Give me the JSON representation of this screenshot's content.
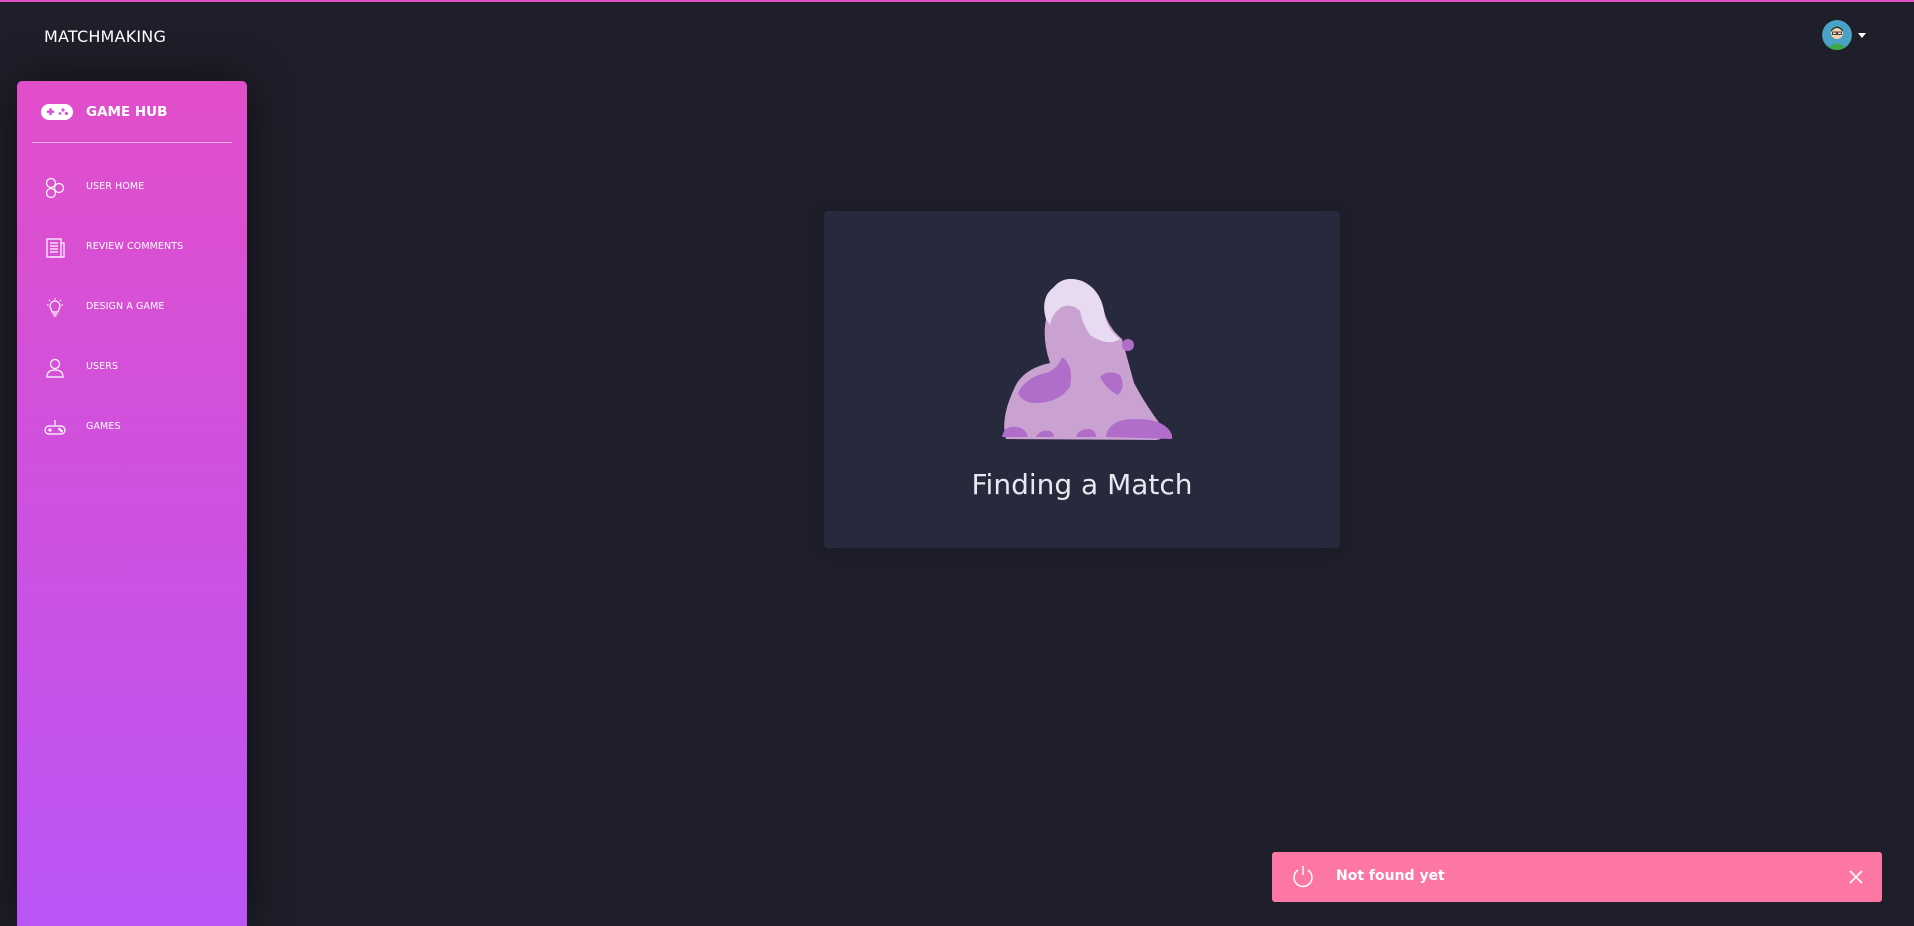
{
  "navbar": {
    "brand": "MATCHMAKING"
  },
  "user_menu": {
    "avatar_icon": "user-avatar",
    "caret_icon": "caret-down-icon"
  },
  "sidebar": {
    "logo": {
      "icon": "gamepad-icon",
      "label": "GAME HUB"
    },
    "items": [
      {
        "label": "USER HOME",
        "icon": "atom-icon"
      },
      {
        "label": "REVIEW COMMENTS",
        "icon": "paper-icon"
      },
      {
        "label": "DESIGN A GAME",
        "icon": "bulb-icon"
      },
      {
        "label": "USERS",
        "icon": "single-user-icon"
      },
      {
        "label": "GAMES",
        "icon": "controller-icon"
      }
    ]
  },
  "main": {
    "card": {
      "title": "Finding a Match",
      "illustration": "purple-blob-illustration"
    }
  },
  "toast": {
    "icon": "power-icon",
    "message": "Not found yet",
    "close_icon": "close-icon"
  },
  "colors": {
    "background": "#1f1f2b",
    "card": "#27293d",
    "sidebar_gradient_start": "#e14eca",
    "sidebar_gradient_end": "#ba54f5",
    "toast": "#fd77a4",
    "accent": "#e14eca"
  }
}
